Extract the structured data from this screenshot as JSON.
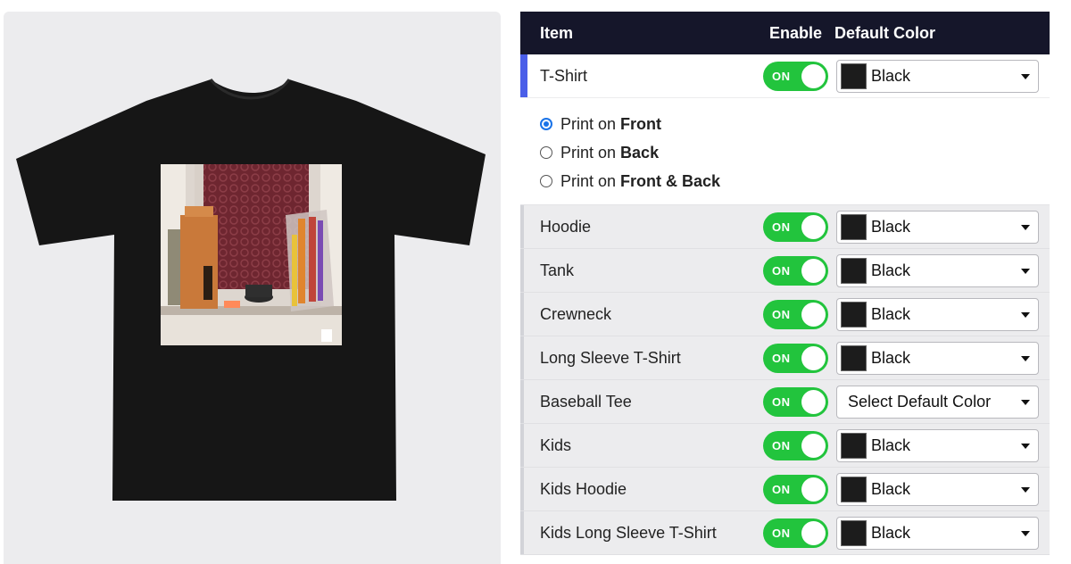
{
  "colors": {
    "header_bg": "#15162a",
    "toggle_on": "#22c43d",
    "active_accent": "#4a5ee8",
    "radio_selected": "#1a73e8",
    "swatch_black": "#1c1c1c"
  },
  "preview": {
    "product": "T-Shirt",
    "shirt_color": "#161616",
    "artwork": "photo of a window sill with incense and a box"
  },
  "table": {
    "headers": {
      "item": "Item",
      "enable": "Enable",
      "default_color": "Default Color"
    },
    "rows": [
      {
        "label": "T-Shirt",
        "toggle": "ON",
        "color": "Black",
        "active": true
      },
      {
        "label": "Hoodie",
        "toggle": "ON",
        "color": "Black"
      },
      {
        "label": "Tank",
        "toggle": "ON",
        "color": "Black"
      },
      {
        "label": "Crewneck",
        "toggle": "ON",
        "color": "Black"
      },
      {
        "label": "Long Sleeve T-Shirt",
        "toggle": "ON",
        "color": "Black"
      },
      {
        "label": "Baseball Tee",
        "toggle": "ON",
        "color": "Select Default Color",
        "placeholder": true
      },
      {
        "label": "Kids",
        "toggle": "ON",
        "color": "Black"
      },
      {
        "label": "Kids Hoodie",
        "toggle": "ON",
        "color": "Black"
      },
      {
        "label": "Kids Long Sleeve T-Shirt",
        "toggle": "ON",
        "color": "Black"
      }
    ],
    "print_options": {
      "prefix": "Print on",
      "options": [
        {
          "label": "Front",
          "checked": true
        },
        {
          "label": "Back",
          "checked": false
        },
        {
          "label": "Front & Back",
          "checked": false
        }
      ]
    }
  }
}
